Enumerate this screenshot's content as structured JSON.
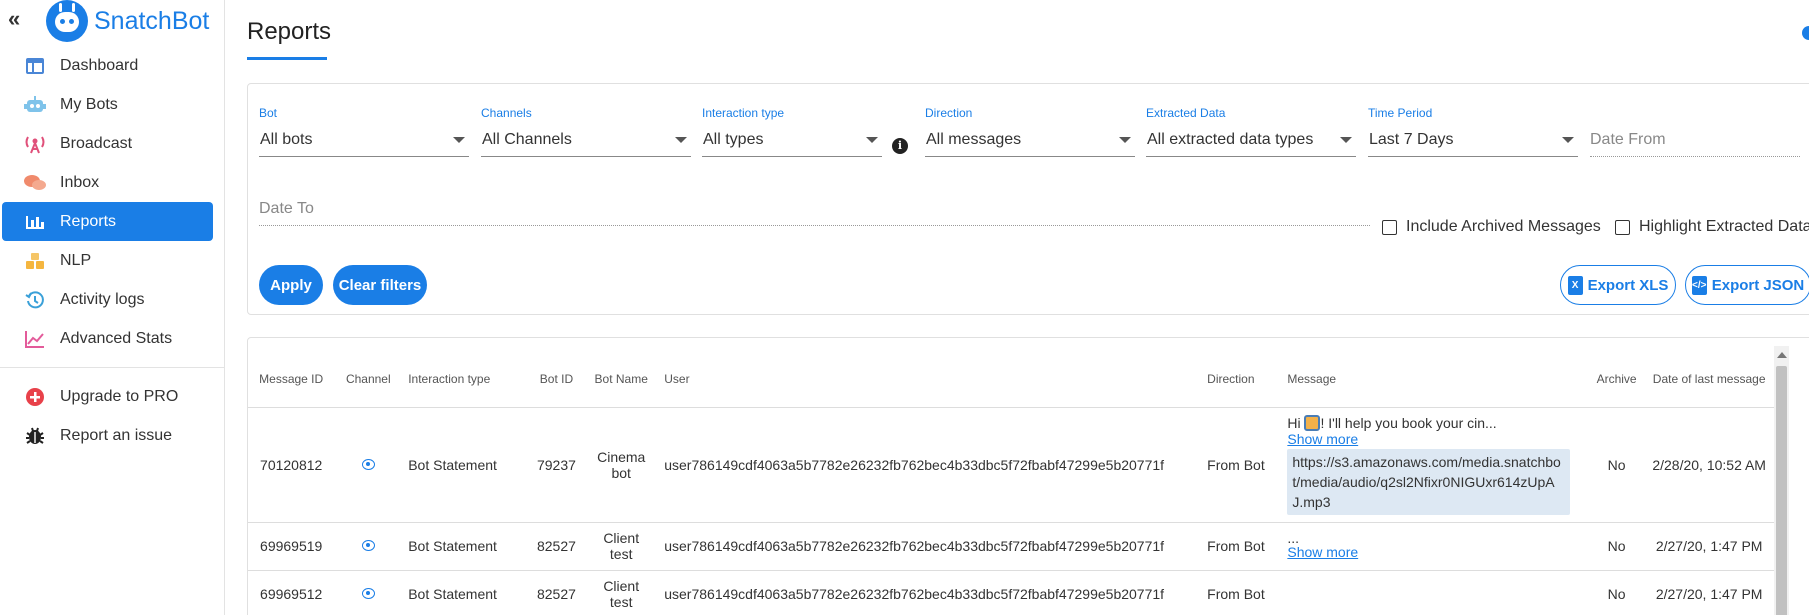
{
  "brand": {
    "name": "SnatchBot"
  },
  "sidebar": {
    "items": [
      {
        "label": "Dashboard",
        "icon": "dashboard-icon"
      },
      {
        "label": "My Bots",
        "icon": "robot-icon"
      },
      {
        "label": "Broadcast",
        "icon": "broadcast-icon"
      },
      {
        "label": "Inbox",
        "icon": "chat-icon"
      },
      {
        "label": "Reports",
        "icon": "bar-chart-icon",
        "active": true
      },
      {
        "label": "NLP",
        "icon": "nlp-icon"
      },
      {
        "label": "Activity logs",
        "icon": "history-icon"
      },
      {
        "label": "Advanced Stats",
        "icon": "trend-icon"
      }
    ],
    "secondary": [
      {
        "label": "Upgrade to PRO",
        "icon": "plus-circle-icon"
      },
      {
        "label": "Report an issue",
        "icon": "bug-icon"
      }
    ]
  },
  "page": {
    "title": "Reports"
  },
  "filters": {
    "bot": {
      "label": "Bot",
      "value": "All bots"
    },
    "channels": {
      "label": "Channels",
      "value": "All Channels"
    },
    "interaction_type": {
      "label": "Interaction type",
      "value": "All types"
    },
    "direction": {
      "label": "Direction",
      "value": "All messages"
    },
    "extracted_data": {
      "label": "Extracted Data",
      "value": "All extracted data types"
    },
    "time_period": {
      "label": "Time Period",
      "value": "Last 7 Days"
    },
    "date_from": {
      "placeholder": "Date From"
    },
    "date_to": {
      "placeholder": "Date To"
    },
    "include_archived": "Include Archived Messages",
    "highlight_extracted": "Highlight Extracted Data",
    "apply": "Apply",
    "clear": "Clear filters",
    "export_xls": "Export XLS",
    "export_json": "Export JSON"
  },
  "table": {
    "headers": {
      "message_id": "Message ID",
      "channel": "Channel",
      "interaction_type": "Interaction type",
      "bot_id": "Bot ID",
      "bot_name": "Bot Name",
      "user": "User",
      "direction": "Direction",
      "message": "Message",
      "archive": "Archive",
      "date": "Date of last message"
    },
    "rows": [
      {
        "message_id": "70120812",
        "interaction_type": "Bot Statement",
        "bot_id": "79237",
        "bot_name": "Cinema bot",
        "user": "user786149cdf4063a5b7782e26232fb762bec4b33dbc5f72fbabf47299e5b20771f",
        "direction": "From Bot",
        "message_text_before": "Hi ",
        "message_text_after": "! I'll help you book your cin...",
        "show_more": "Show more",
        "attachment": "https://s3.amazonaws.com/media.snatchbot/media/audio/q2sl2Nfixr0NIGUxr614zUpAJ.mp3",
        "archive": "No",
        "date": "2/28/20, 10:52 AM"
      },
      {
        "message_id": "69969519",
        "interaction_type": "Bot Statement",
        "bot_id": "82527",
        "bot_name": "Client test",
        "user": "user786149cdf4063a5b7782e26232fb762bec4b33dbc5f72fbabf47299e5b20771f",
        "direction": "From Bot",
        "message_text": "...",
        "show_more": "Show more",
        "archive": "No",
        "date": "2/27/20, 1:47 PM"
      },
      {
        "message_id": "69969512",
        "interaction_type": "Bot Statement",
        "bot_id": "82527",
        "bot_name": "Client test",
        "user": "user786149cdf4063a5b7782e26232fb762bec4b33dbc5f72fbabf47299e5b20771f",
        "direction": "From Bot",
        "archive": "No",
        "date": "2/27/20, 1:47 PM"
      }
    ]
  }
}
